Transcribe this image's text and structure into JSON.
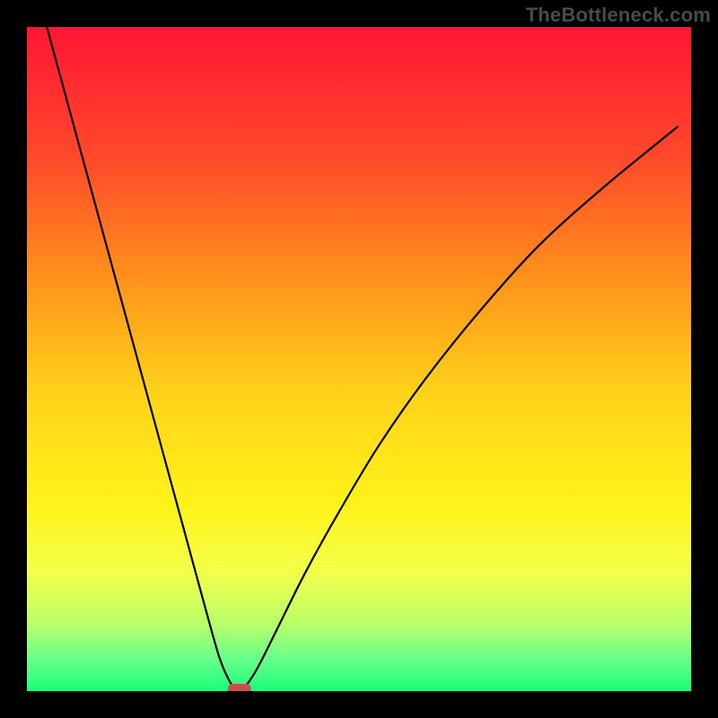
{
  "watermark": "TheBottleneck.com",
  "chart_data": {
    "type": "line",
    "title": "",
    "xlabel": "",
    "ylabel": "",
    "xlim": [
      0,
      100
    ],
    "ylim": [
      0,
      100
    ],
    "optimal_x": 32,
    "curve": {
      "x": [
        3,
        6,
        9,
        12,
        15,
        18,
        21,
        24,
        27,
        29,
        30.5,
        31.5,
        32,
        32.5,
        33.5,
        35,
        38,
        42,
        47,
        53,
        60,
        68,
        77,
        87,
        98
      ],
      "y": [
        100,
        89,
        78,
        67,
        56,
        45,
        34,
        23,
        12,
        5,
        1.5,
        0.3,
        0,
        0.3,
        1.5,
        4,
        10,
        18,
        27,
        37,
        47,
        57,
        67,
        76,
        85
      ]
    },
    "marker": {
      "x": 32,
      "y": 0,
      "shape": "rounded-rect",
      "color": "#c94f4f"
    },
    "background_gradient": [
      {
        "offset": 0.0,
        "color": "#ff1634"
      },
      {
        "offset": 0.2,
        "color": "#ff4a2a"
      },
      {
        "offset": 0.4,
        "color": "#ff9a1a"
      },
      {
        "offset": 0.55,
        "color": "#ffd21a"
      },
      {
        "offset": 0.72,
        "color": "#fff31a"
      },
      {
        "offset": 0.82,
        "color": "#f3ff4a"
      },
      {
        "offset": 0.9,
        "color": "#b8ff6a"
      },
      {
        "offset": 0.95,
        "color": "#6aff8a"
      },
      {
        "offset": 1.0,
        "color": "#1aff7a"
      }
    ],
    "annotations": []
  }
}
